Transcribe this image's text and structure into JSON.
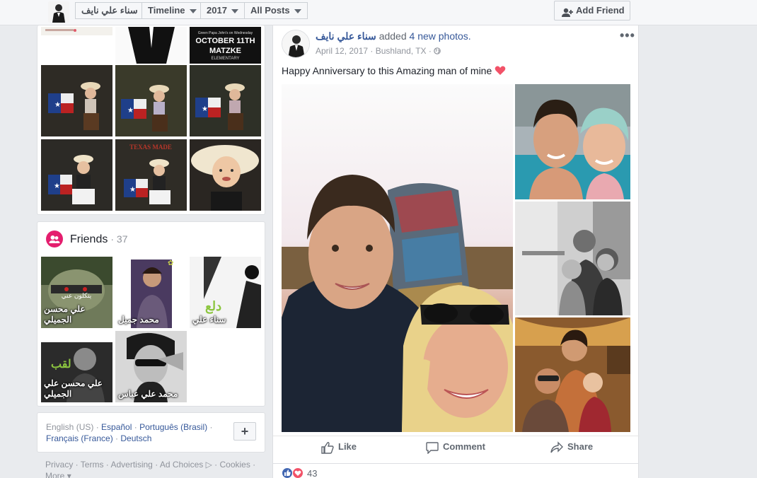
{
  "topbar": {
    "profile_name": "سناء علي نايف",
    "timeline_label": "Timeline",
    "year_label": "2017",
    "filter_label": "All Posts",
    "add_friend_label": "Add Friend"
  },
  "photos_strip": {
    "poster_lines": [
      "October 11th",
      "Matzke",
      "Elementary"
    ],
    "poster_small": "Green Papa John's on Wednesday",
    "texas_made": "TEXAS MADE"
  },
  "friends": {
    "title": "Friends",
    "count": "· 37",
    "items": [
      {
        "name": "علي محسن الجميلي"
      },
      {
        "name": "محمد جميل"
      },
      {
        "name": "سناء علي"
      },
      {
        "name": "علي محسن علي الجميلي"
      },
      {
        "name": "محمد علي عباس"
      }
    ]
  },
  "languages": {
    "current": "English (US)",
    "links": [
      "Español",
      "Português (Brasil)",
      "Français (France)",
      "Deutsch"
    ],
    "add_label": "+"
  },
  "footer": {
    "links": [
      "Privacy",
      "Terms",
      "Advertising",
      "Ad Choices",
      "Cookies",
      "More"
    ]
  },
  "post": {
    "author": "سناء علي نايف",
    "action": "added",
    "count_text": "4 new photos.",
    "date": "April 12, 2017",
    "location": "Bushland, TX",
    "menu": "•••",
    "text": "Happy Anniversary to this Amazing man of mine",
    "actions": {
      "like": "Like",
      "comment": "Comment",
      "share": "Share"
    },
    "reaction_count": "43",
    "colors": {
      "link": "#365899",
      "heart": "#f25268",
      "like_blue": "#4267b2"
    }
  }
}
